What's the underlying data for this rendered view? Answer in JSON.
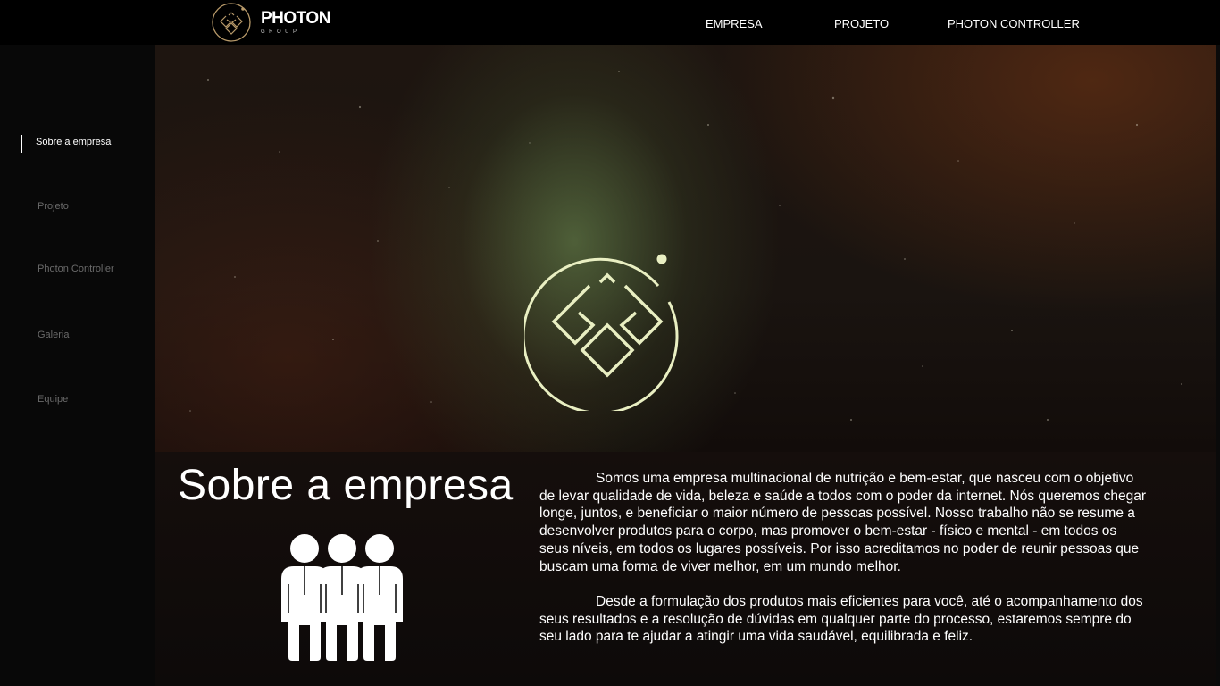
{
  "header": {
    "logo_word": "PHOTON",
    "logo_sub": "GROUP",
    "nav": [
      "EMPRESA",
      "PROJETO",
      "PHOTON CONTROLLER"
    ]
  },
  "sidebar": {
    "items": [
      {
        "label": "Sobre a empresa",
        "active": true
      },
      {
        "label": "Projeto",
        "active": false
      },
      {
        "label": "Photon Controller",
        "active": false
      },
      {
        "label": "Galeria",
        "active": false
      },
      {
        "label": "Equipe",
        "active": false
      }
    ]
  },
  "hero": {
    "emblem_icon": "photon-emblem-icon",
    "accent": "#e9efc2"
  },
  "about": {
    "title": "Sobre a empresa",
    "icon": "people-group-icon",
    "paragraphs": [
      "Somos uma empresa multinacional de nutrição e bem-estar, que nasceu com o objetivo de levar qualidade de vida, beleza e saúde a todos com o poder da internet. Nós queremos chegar longe, juntos, e beneficiar o maior número de pessoas possível. Nosso trabalho não se resume a desenvolver produtos para o corpo, mas promover o bem-estar - físico e mental - em todos os seus níveis, em todos os lugares possíveis. Por isso acreditamos no poder de reunir pessoas que buscam uma forma de viver melhor, em um mundo melhor.",
      "Desde a formulação dos produtos mais eficientes para você, até o acompanhamento dos seus resultados e a resolução de dúvidas em qualquer parte do processo, estaremos sempre do seu lado para te ajudar a atingir uma vida saudável, equilibrada e feliz."
    ]
  }
}
